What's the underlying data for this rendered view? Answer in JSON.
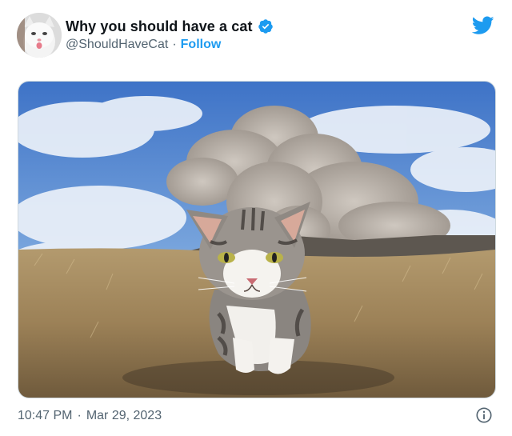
{
  "tweet": {
    "display_name": "Why you should have a cat",
    "handle": "@ShouldHaveCat",
    "separator": "·",
    "follow_label": "Follow",
    "time": "10:47 PM",
    "date": "Mar 29, 2023",
    "footer_separator": "·"
  },
  "icons": {
    "verified": "verified-badge-icon",
    "twitter": "twitter-bird-icon",
    "info": "info-icon"
  },
  "colors": {
    "accent": "#1d9bf0",
    "secondary_text": "#536471",
    "primary_text": "#0f1419"
  }
}
